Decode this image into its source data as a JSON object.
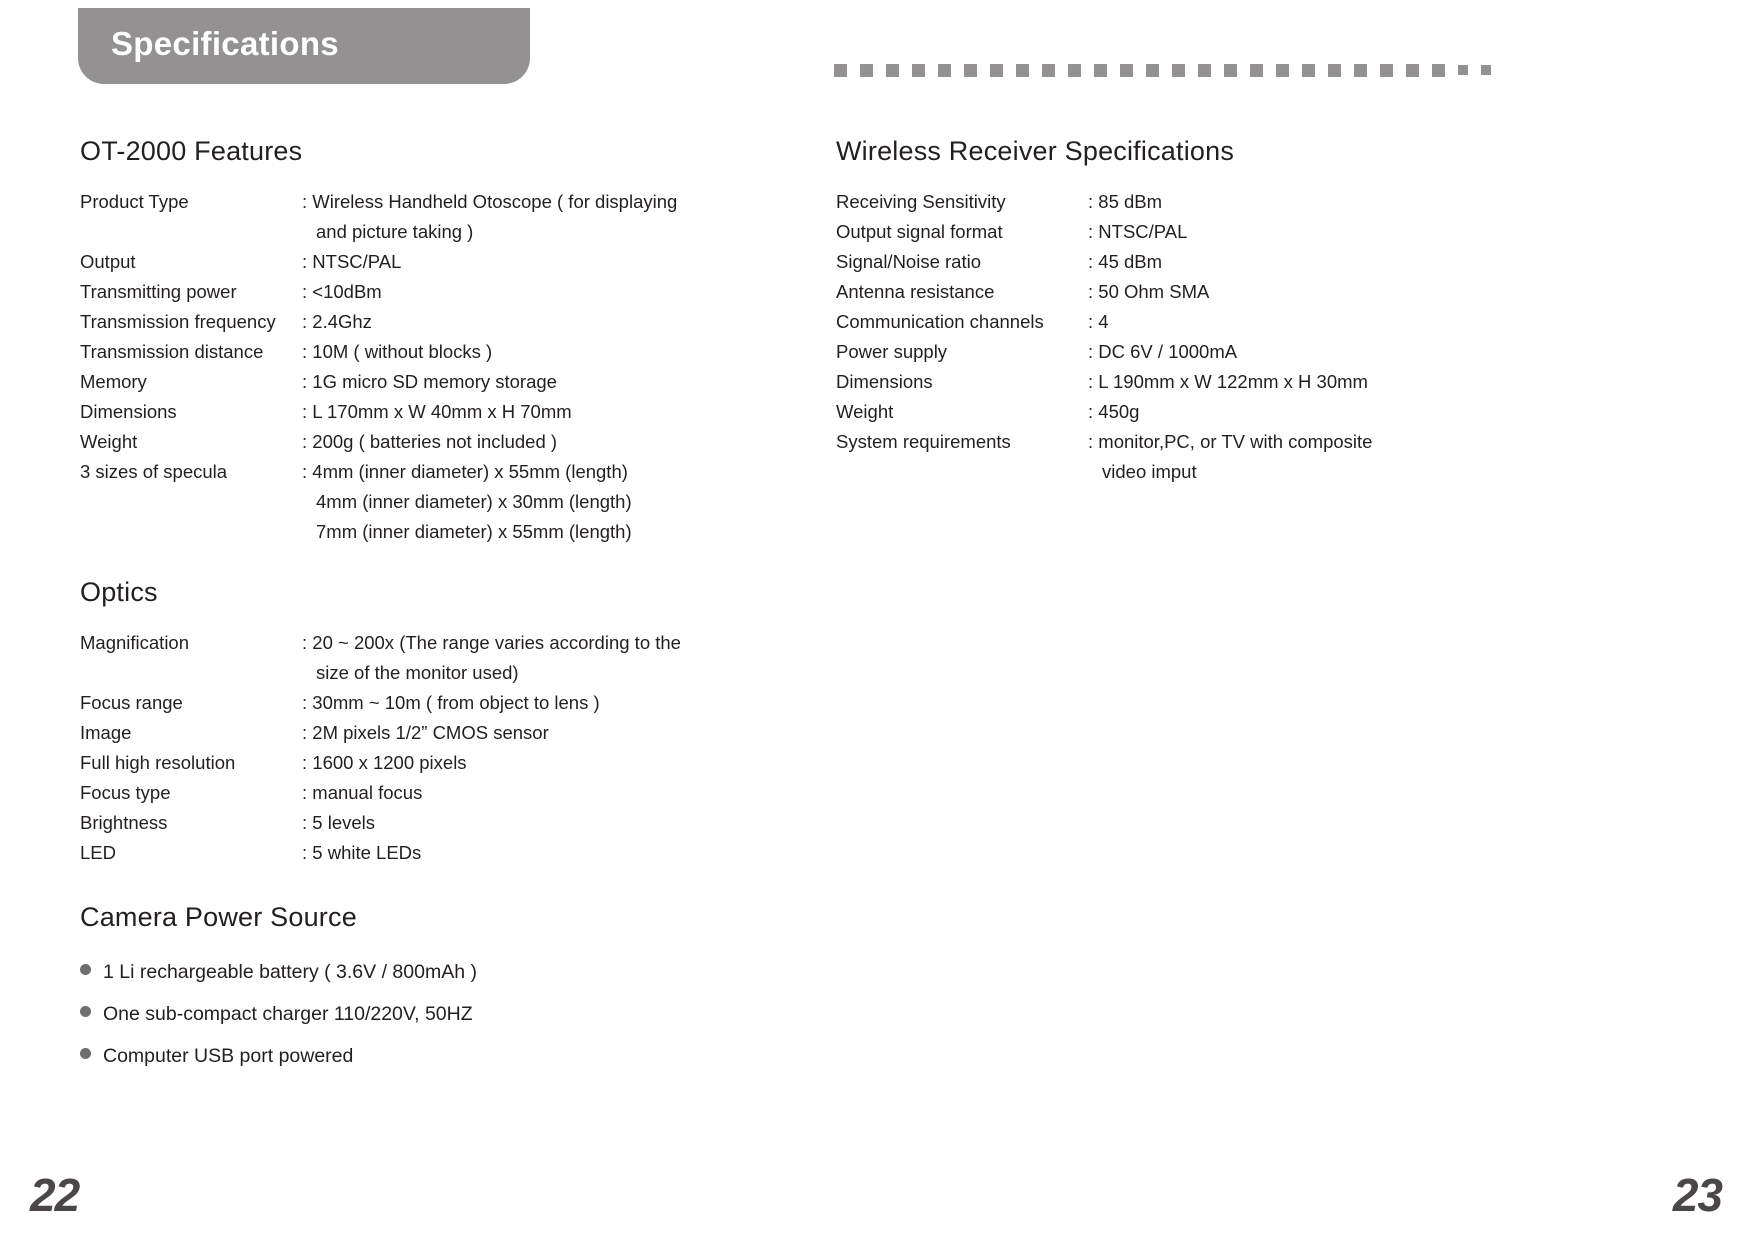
{
  "header": {
    "tab_title": "Specifications"
  },
  "decor": {
    "square_count": 26,
    "square_color": "#949192"
  },
  "left_column": {
    "sections": [
      {
        "title": "OT-2000 Features",
        "rows": [
          {
            "label": "Product Type",
            "value": ": Wireless Handheld Otoscope ( for displaying"
          },
          {
            "label": "",
            "value": "and picture taking )"
          },
          {
            "label": "Output",
            "value": ": NTSC/PAL"
          },
          {
            "label": "Transmitting power",
            "value": ": <10dBm"
          },
          {
            "label": "Transmission frequency",
            "value": ": 2.4Ghz"
          },
          {
            "label": "Transmission distance",
            "value": ": 10M ( without blocks )"
          },
          {
            "label": "Memory",
            "value": ": 1G micro SD memory storage"
          },
          {
            "label": "Dimensions",
            "value": ": L 170mm   x   W 40mm   x   H 70mm"
          },
          {
            "label": "Weight",
            "value": ": 200g ( batteries not included )"
          },
          {
            "label": "3 sizes of specula",
            "value": ": 4mm (inner diameter)  x  55mm (length)"
          },
          {
            "label": "",
            "value": "4mm (inner diameter)  x  30mm (length)"
          },
          {
            "label": "",
            "value": "7mm (inner diameter)  x  55mm (length)"
          }
        ]
      },
      {
        "title": "Optics",
        "rows": [
          {
            "label": "Magnification",
            "value": ": 20 ~ 200x (The range varies according to the"
          },
          {
            "label": "",
            "value": "size of the monitor used)"
          },
          {
            "label": "Focus range",
            "value": ": 30mm ~ 10m ( from object to lens )"
          },
          {
            "label": "Image",
            "value": ": 2M pixels  1/2” CMOS sensor"
          },
          {
            "label": "Full high resolution",
            "value": ": 1600 x 1200 pixels"
          },
          {
            "label": "Focus type",
            "value": ": manual focus"
          },
          {
            "label": "Brightness",
            "value": ": 5 levels"
          },
          {
            "label": "LED",
            "value": ": 5 white LEDs"
          }
        ]
      },
      {
        "title": "Camera Power Source",
        "bullets": [
          "1 Li rechargeable battery ( 3.6V / 800mAh )",
          "One sub-compact charger 110/220V, 50HZ",
          "Computer USB port powered"
        ]
      }
    ]
  },
  "right_column": {
    "sections": [
      {
        "title": "Wireless Receiver Specifications",
        "rows": [
          {
            "label": "Receiving Sensitivity",
            "value": ": 85 dBm"
          },
          {
            "label": "Output signal format",
            "value": ": NTSC/PAL"
          },
          {
            "label": "Signal/Noise ratio",
            "value": ": 45 dBm"
          },
          {
            "label": "Antenna resistance",
            "value": ": 50 Ohm SMA"
          },
          {
            "label": "Communication channels",
            "value": ": 4"
          },
          {
            "label": "Power supply",
            "value": ": DC 6V / 1000mA"
          },
          {
            "label": "Dimensions",
            "value": ": L 190mm  x  W 122mm  x  H 30mm"
          },
          {
            "label": "Weight",
            "value": ": 450g"
          },
          {
            "label": "System requirements",
            "value": ": monitor,PC, or TV with composite"
          },
          {
            "label": "",
            "value": "video imput"
          }
        ]
      }
    ]
  },
  "page_numbers": {
    "left": "22",
    "right": "23"
  }
}
